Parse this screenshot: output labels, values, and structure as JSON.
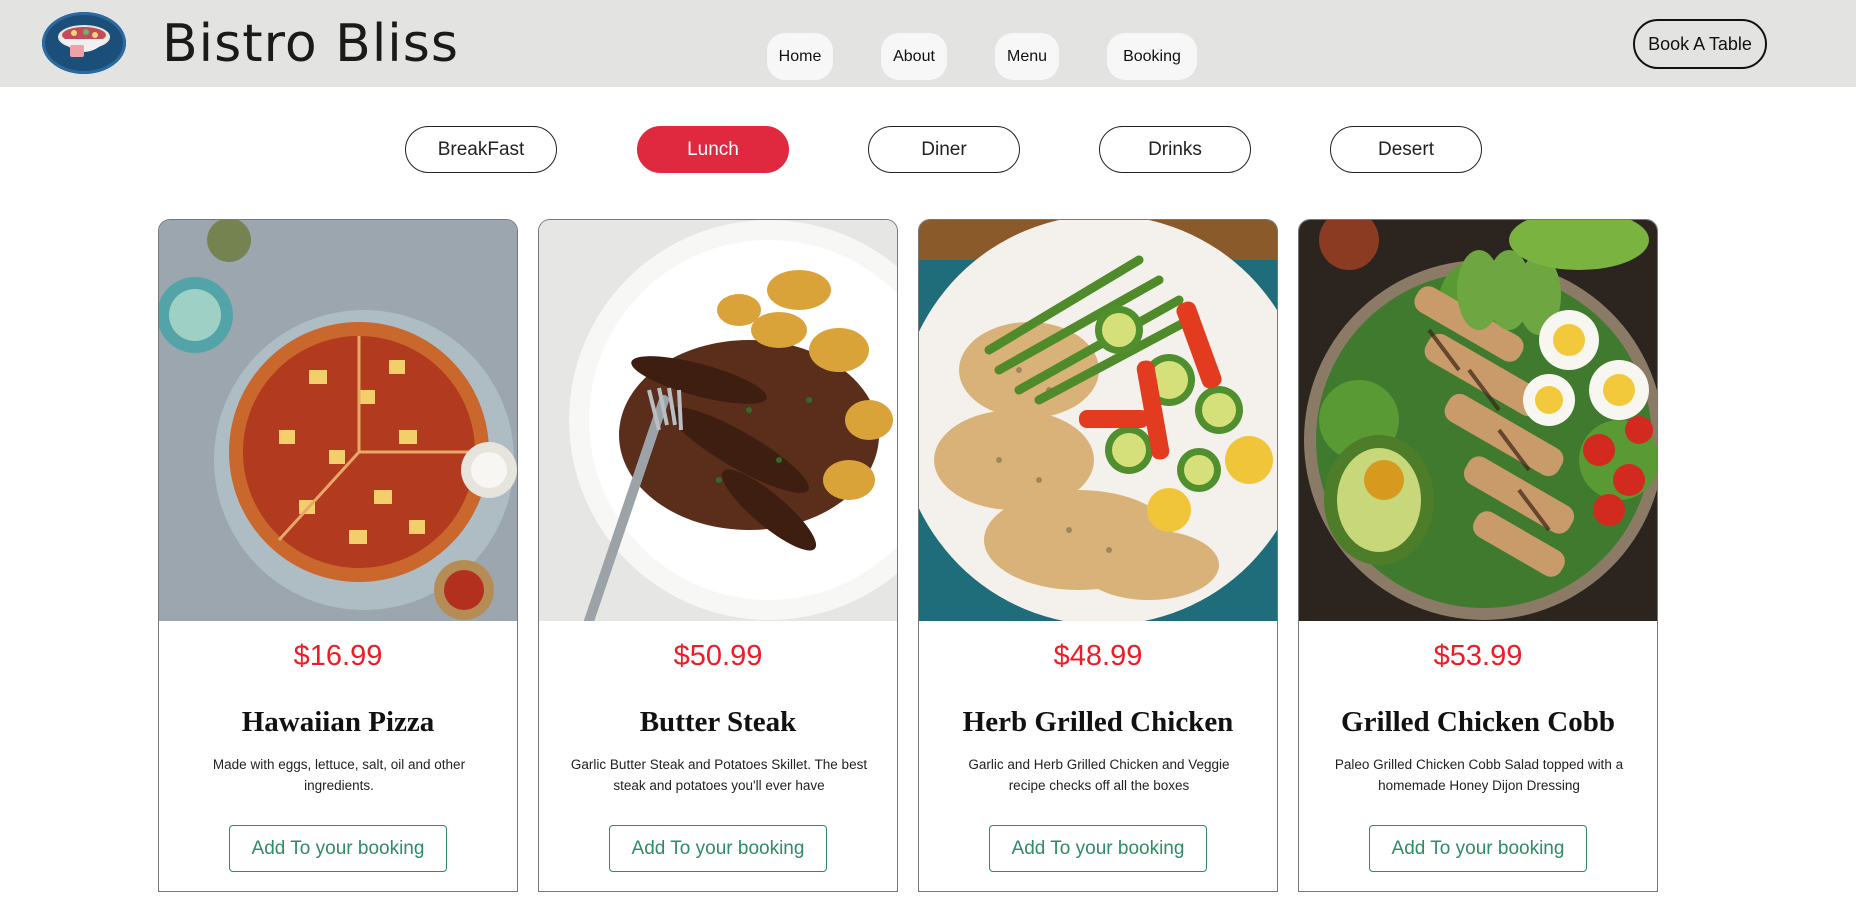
{
  "header": {
    "brand": "Bistro Bliss",
    "nav": [
      {
        "label": "Home"
      },
      {
        "label": "About"
      },
      {
        "label": "Menu"
      },
      {
        "label": "Booking"
      }
    ],
    "cta": "Book A Table"
  },
  "categories": [
    {
      "label": "BreakFast",
      "active": false
    },
    {
      "label": "Lunch",
      "active": true
    },
    {
      "label": "Diner",
      "active": false
    },
    {
      "label": "Drinks",
      "active": false
    },
    {
      "label": "Desert",
      "active": false
    }
  ],
  "colors": {
    "accent": "#e0283e",
    "price": "#ee1c25",
    "button": "#2e8b64",
    "header_bg": "#e3e3e1"
  },
  "menu_items": [
    {
      "price": "$16.99",
      "name": "Hawaiian Pizza",
      "description": "Made with eggs, lettuce, salt, oil and other ingredients.",
      "button": "Add To your booking",
      "image": "hawaiian-pizza-photo"
    },
    {
      "price": "$50.99",
      "name": "Butter Steak",
      "description": "Garlic Butter Steak and Potatoes Skillet. The best steak and potatoes you'll ever have",
      "button": "Add To your booking",
      "image": "butter-steak-photo"
    },
    {
      "price": "$48.99",
      "name": "Herb Grilled Chicken",
      "description": "Garlic and Herb Grilled Chicken and Veggie recipe checks off all the boxes",
      "button": "Add To your booking",
      "image": "herb-grilled-chicken-photo"
    },
    {
      "price": "$53.99",
      "name": "Grilled Chicken Cobb",
      "description": "Paleo Grilled Chicken Cobb Salad topped with a homemade Honey Dijon Dressing",
      "button": "Add To your booking",
      "image": "grilled-chicken-cobb-photo"
    }
  ]
}
